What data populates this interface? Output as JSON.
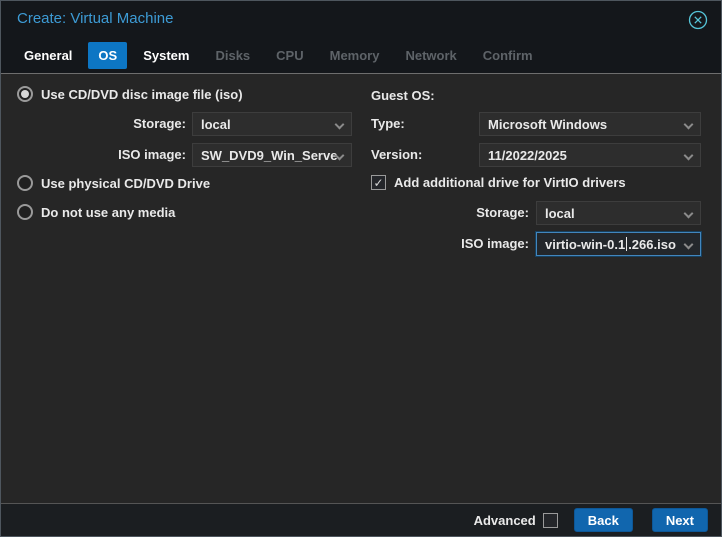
{
  "window": {
    "title": "Create: Virtual Machine"
  },
  "icons": {
    "close": "circle-x",
    "chevron": "chevron-down",
    "check": "✓"
  },
  "colors": {
    "accent_blue": "#0d76c4",
    "button_blue": "#1166ae",
    "title_blue": "#3d9bd5",
    "close_teal": "#55c4d8",
    "panel_bg": "#262626",
    "chrome_bg": "#14171b",
    "focus_border": "#4286bd"
  },
  "tabs": [
    {
      "label": "General",
      "state": "enabled"
    },
    {
      "label": "OS",
      "state": "selected"
    },
    {
      "label": "System",
      "state": "enabled"
    },
    {
      "label": "Disks",
      "state": "disabled"
    },
    {
      "label": "CPU",
      "state": "disabled"
    },
    {
      "label": "Memory",
      "state": "disabled"
    },
    {
      "label": "Network",
      "state": "disabled"
    },
    {
      "label": "Confirm",
      "state": "disabled"
    }
  ],
  "left": {
    "radio_iso": {
      "label": "Use CD/DVD disc image file (iso)",
      "selected": true
    },
    "storage": {
      "label": "Storage:",
      "value": "local"
    },
    "iso_image": {
      "label": "ISO image:",
      "value": "SW_DVD9_Win_Serve"
    },
    "radio_physical": {
      "label": "Use physical CD/DVD Drive",
      "selected": false
    },
    "radio_no_media": {
      "label": "Do not use any media",
      "selected": false
    }
  },
  "right": {
    "guest_os_heading": "Guest OS:",
    "type": {
      "label": "Type:",
      "value": "Microsoft Windows"
    },
    "version": {
      "label": "Version:",
      "value": "11/2022/2025"
    },
    "virtio_checkbox": {
      "label": "Add additional drive for VirtIO drivers",
      "checked": true
    },
    "storage": {
      "label": "Storage:",
      "value": "local"
    },
    "iso_image": {
      "label": "ISO image:",
      "value_before_caret": "virtio-win-0.1",
      "value_after_caret": ".266.iso"
    }
  },
  "footer": {
    "advanced_label": "Advanced",
    "advanced_checked": false,
    "back_label": "Back",
    "next_label": "Next"
  }
}
